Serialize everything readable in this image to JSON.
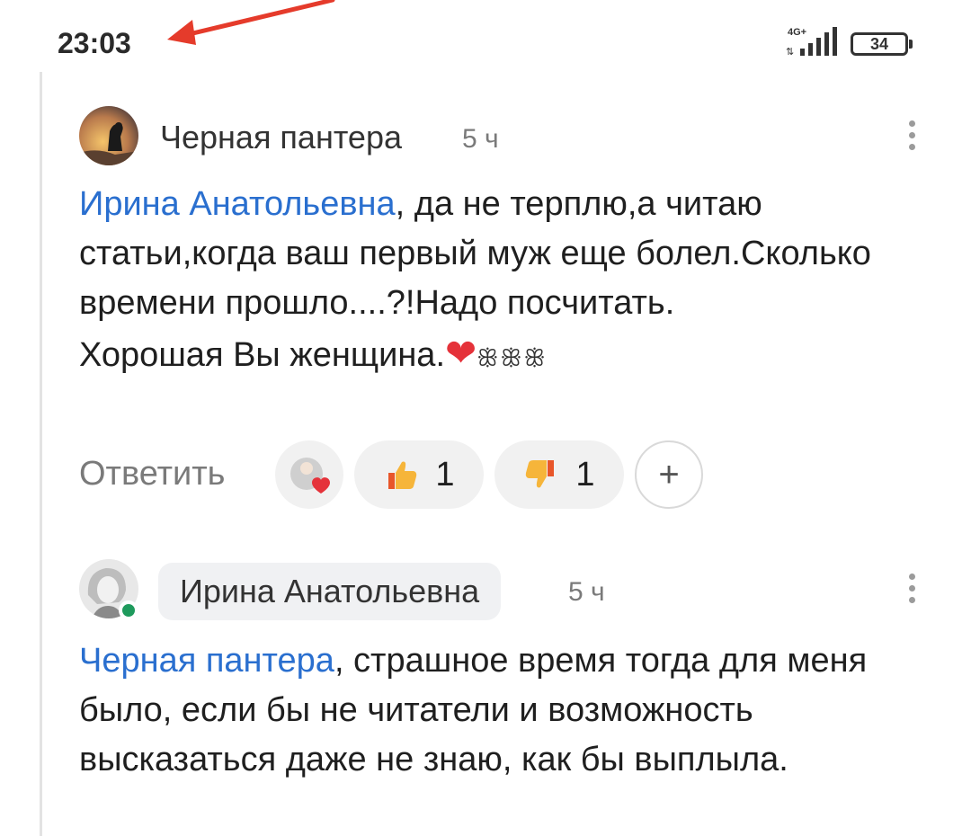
{
  "status_bar": {
    "time": "23:03",
    "network": "4G+",
    "battery": "34",
    "battery_level": 0.34
  },
  "comments": [
    {
      "author": "Черная пантера",
      "time_ago": "5 ч",
      "mention": "Ирина Анатольевна",
      "text": ", да не терплю,а читаю статьи,когда ваш первый муж еще болел.Сколько времени прошло....?!Надо посчитать.",
      "text_line2": "Хорошая Вы женщина.",
      "emoji": "❤",
      "sprouts": "ꕥꕥꕥ",
      "reply_label": "Ответить",
      "likes": "1",
      "dislikes": "1",
      "add_label": "+"
    },
    {
      "author": "Ирина Анатольевна",
      "time_ago": "5 ч",
      "mention": "Черная пантера",
      "text": ", страшное время тогда для меня было, если бы не читатели и возможность высказаться даже не знаю, как бы выплыла."
    }
  ],
  "colors": {
    "mention": "#2a6fcf",
    "online": "#1e9a5c",
    "annotation_arrow": "#e53b2b"
  }
}
